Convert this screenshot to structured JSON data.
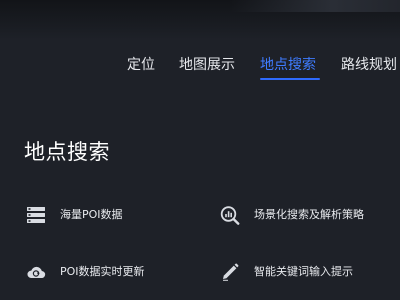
{
  "nav": {
    "tabs": [
      {
        "label": "定位"
      },
      {
        "label": "地图展示"
      },
      {
        "label": "地点搜索",
        "active": true
      },
      {
        "label": "路线规划"
      }
    ]
  },
  "section": {
    "title": "地点搜索",
    "features": [
      {
        "label": "海量POI数据",
        "icon": "database-list-icon"
      },
      {
        "label": "场景化搜索及解析策略",
        "icon": "analytics-search-icon"
      },
      {
        "label": "POI数据实时更新",
        "icon": "cloud-sync-icon"
      },
      {
        "label": "智能关键词输入提示",
        "icon": "pencil-icon"
      }
    ]
  },
  "colors": {
    "background": "#1e2128",
    "accent": "#2f6bff",
    "text": "#ffffff"
  }
}
